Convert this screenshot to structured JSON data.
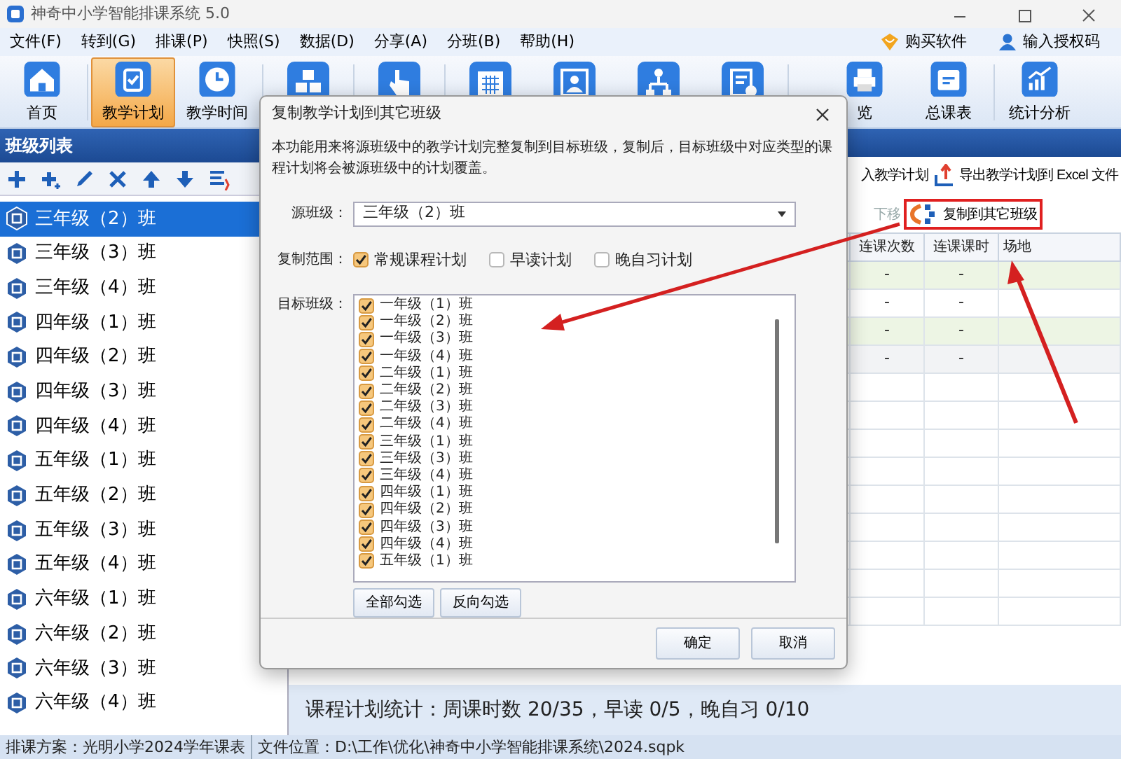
{
  "window": {
    "title": "神奇中小学智能排课系统 5.0"
  },
  "menu": [
    "文件(F)",
    "转到(G)",
    "排课(P)",
    "快照(S)",
    "数据(D)",
    "分享(A)",
    "分班(B)",
    "帮助(H)"
  ],
  "header_links": [
    {
      "kind": "buy",
      "label": "购买软件"
    },
    {
      "kind": "user",
      "label": "输入授权码"
    }
  ],
  "toolbar": [
    {
      "kind": "home",
      "label": "首页",
      "selected": false,
      "divider_before": false
    },
    {
      "kind": "plan",
      "label": "教学计划",
      "selected": true,
      "divider_before": true
    },
    {
      "kind": "clock",
      "label": "教学时间",
      "selected": false,
      "divider_before": false
    },
    {
      "kind": "cubes",
      "selected": false,
      "divider_before": true
    },
    {
      "kind": "hand",
      "selected": false,
      "divider_before": true
    },
    {
      "kind": "calendar",
      "selected": false,
      "divider_before": true
    },
    {
      "kind": "people",
      "selected": false,
      "divider_before": false
    },
    {
      "kind": "tree",
      "selected": false,
      "divider_before": false
    },
    {
      "kind": "form",
      "selected": false,
      "divider_before": false
    },
    {
      "kind": "print",
      "label": "览",
      "selected": false,
      "divider_before": true
    },
    {
      "kind": "schedule",
      "label": "总课表",
      "selected": false,
      "divider_before": false
    },
    {
      "kind": "chart",
      "label": "统计分析",
      "selected": false,
      "divider_before": true
    }
  ],
  "sidebar": {
    "title": "班级列表",
    "tools": [
      {
        "kind": "add"
      },
      {
        "kind": "add-multiple"
      },
      {
        "kind": "edit"
      },
      {
        "kind": "delete"
      },
      {
        "kind": "up"
      },
      {
        "kind": "down"
      },
      {
        "kind": "list"
      }
    ],
    "items": [
      {
        "label": "三年级（2）班",
        "selected": true
      },
      {
        "label": "三年级（3）班",
        "selected": false
      },
      {
        "label": "三年级（4）班",
        "selected": false
      },
      {
        "label": "四年级（1）班",
        "selected": false
      },
      {
        "label": "四年级（2）班",
        "selected": false
      },
      {
        "label": "四年级（3）班",
        "selected": false
      },
      {
        "label": "四年级（4）班",
        "selected": false
      },
      {
        "label": "五年级（1）班",
        "selected": false
      },
      {
        "label": "五年级（2）班",
        "selected": false
      },
      {
        "label": "五年级（3）班",
        "selected": false
      },
      {
        "label": "五年级（4）班",
        "selected": false
      },
      {
        "label": "六年级（1）班",
        "selected": false
      },
      {
        "label": "六年级（2）班",
        "selected": false
      },
      {
        "label": "六年级（3）班",
        "selected": false
      },
      {
        "label": "六年级（4）班",
        "selected": false
      }
    ]
  },
  "plan_panel": {
    "actions": [
      {
        "kind": "import",
        "label": "入教学计划"
      },
      {
        "kind": "export",
        "label": "导出教学计划到 Excel 文件"
      }
    ],
    "tools": [
      {
        "kind": "down",
        "label": "下移",
        "disabled": true
      },
      {
        "kind": "copy",
        "label": "复制到其它班级",
        "disabled": false
      }
    ],
    "table": {
      "columns": [
        "连课次数",
        "连课课时",
        "场地"
      ],
      "rows": [
        {
          "cells": [
            "-",
            "-"
          ]
        },
        {
          "cells": [
            "-",
            "-"
          ]
        },
        {
          "cells": [
            "-",
            "-"
          ]
        },
        {
          "cells": [
            "-",
            "-"
          ]
        }
      ]
    },
    "summary": "课程计划统计：周课时数 20/35，早读 0/5，晚自习 0/10"
  },
  "status_bar": [
    "排课方案：光明小学2024学年课表",
    "文件位置：D:\\工作\\优化\\神奇中小学智能排课系统\\2024.sqpk"
  ],
  "dialog": {
    "title": "复制教学计划到其它班级",
    "description": "本功能用来将源班级中的教学计划完整复制到目标班级，复制后，目标班级中对应类型的课程计划将会被源班级中的计划覆盖。",
    "source_label": "源班级：",
    "source_value": "三年级（2）班",
    "scope_label": "复制范围：",
    "scope_options": [
      {
        "label": "常规课程计划",
        "checked": true
      },
      {
        "label": "早读计划",
        "checked": false
      },
      {
        "label": "晚自习计划",
        "checked": false
      }
    ],
    "target_label": "目标班级：",
    "targets": [
      {
        "label": "一年级（1）班",
        "checked": true
      },
      {
        "label": "一年级（2）班",
        "checked": true
      },
      {
        "label": "一年级（3）班",
        "checked": true
      },
      {
        "label": "一年级（4）班",
        "checked": true
      },
      {
        "label": "二年级（1）班",
        "checked": true
      },
      {
        "label": "二年级（2）班",
        "checked": true
      },
      {
        "label": "二年级（3）班",
        "checked": true
      },
      {
        "label": "二年级（4）班",
        "checked": true
      },
      {
        "label": "三年级（1）班",
        "checked": true
      },
      {
        "label": "三年级（3）班",
        "checked": true
      },
      {
        "label": "三年级（4）班",
        "checked": true
      },
      {
        "label": "四年级（1）班",
        "checked": true
      },
      {
        "label": "四年级（2）班",
        "checked": true
      },
      {
        "label": "四年级（3）班",
        "checked": true
      },
      {
        "label": "四年级（4）班",
        "checked": true
      },
      {
        "label": "五年级（1）班",
        "checked": true
      }
    ],
    "list_buttons": [
      "全部勾选",
      "反向勾选"
    ],
    "buttons": [
      "确定",
      "取消"
    ]
  }
}
